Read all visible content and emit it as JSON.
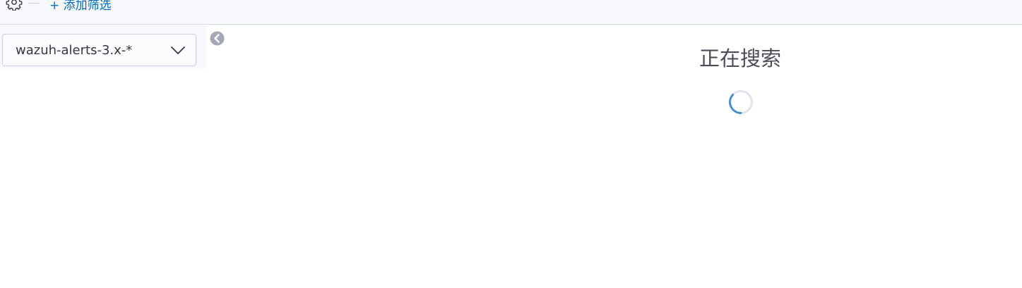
{
  "toolbar": {
    "settings_icon": "gear-icon",
    "add_filter_label": "+ 添加筛选"
  },
  "sidebar": {
    "index_pattern": "wazuh-alerts-3.x-*",
    "dropdown_icon": "chevron-down-icon",
    "collapse_icon": "chevron-left-circle-icon"
  },
  "main": {
    "status_text": "正在搜索",
    "spinner_icon": "loading-spinner-icon"
  },
  "colors": {
    "link": "#006bb4",
    "border": "#d3dae6",
    "toolbar_bg": "#f7f8fc",
    "spinner_accent": "#4a90c8"
  }
}
